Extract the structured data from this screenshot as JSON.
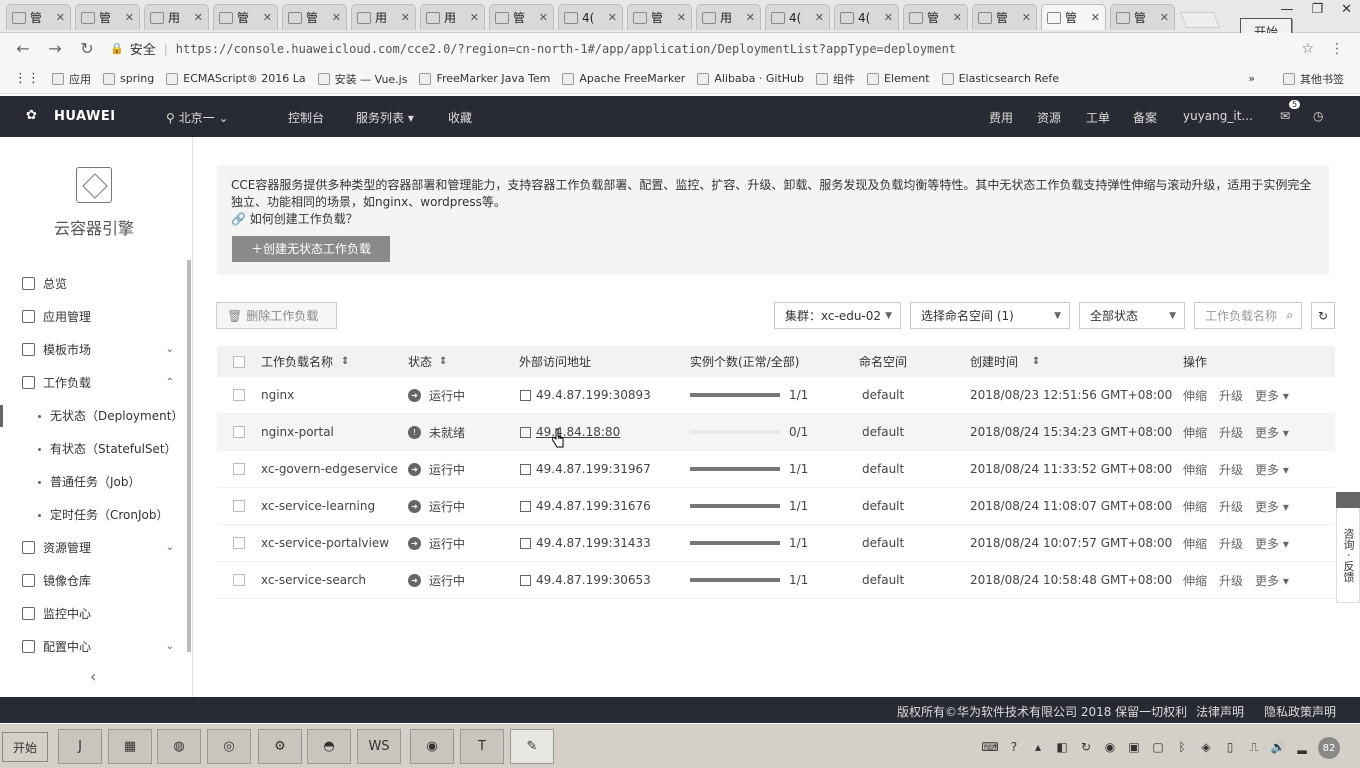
{
  "browser": {
    "tabs": [
      {
        "label": "管"
      },
      {
        "label": "管"
      },
      {
        "label": "用"
      },
      {
        "label": "管"
      },
      {
        "label": "管"
      },
      {
        "label": "用"
      },
      {
        "label": "用"
      },
      {
        "label": "管"
      },
      {
        "label": "4("
      },
      {
        "label": "管"
      },
      {
        "label": "用"
      },
      {
        "label": "4("
      },
      {
        "label": "4("
      },
      {
        "label": "管"
      },
      {
        "label": "管"
      },
      {
        "label": "管",
        "active": true
      },
      {
        "label": "管"
      }
    ],
    "tab_close": "✕",
    "start_popup": "开始",
    "popup_tag": "Po",
    "secure_label": "安全",
    "url": "https://console.huaweicloud.com/cce2.0/?region=cn-north-1#/app/application/DeploymentList?appType=deployment",
    "bookmarks": [
      "应用",
      "spring",
      "ECMAScript® 2016 La",
      "安装 — Vue.js",
      "FreeMarker Java Tem",
      "Apache FreeMarker",
      "Alibaba · GitHub",
      "组件",
      "Element",
      "Elasticsearch Refe"
    ],
    "bookmarks_more": "»",
    "other_bookmarks": "其他书签"
  },
  "header": {
    "brand": "HUAWEI",
    "region": "北京一",
    "nav": [
      "控制台",
      "服务列表 ▾",
      "收藏"
    ],
    "right": [
      "费用",
      "资源",
      "工单",
      "备案",
      "yuyang_it..."
    ],
    "notify_count": "5"
  },
  "sidebar": {
    "title": "云容器引擎",
    "items": [
      {
        "label": "总览"
      },
      {
        "label": "应用管理"
      },
      {
        "label": "模板市场",
        "chev": "⌄"
      },
      {
        "label": "工作负载",
        "chev": "⌃"
      },
      {
        "label": "无状态（Deployment）",
        "sub": true,
        "selected": true
      },
      {
        "label": "有状态（StatefulSet）",
        "sub": true
      },
      {
        "label": "普通任务（Job）",
        "sub": true
      },
      {
        "label": "定时任务（CronJob）",
        "sub": true
      },
      {
        "label": "资源管理",
        "chev": "⌄"
      },
      {
        "label": "镜像仓库"
      },
      {
        "label": "监控中心"
      },
      {
        "label": "配置中心",
        "chev": "⌄"
      }
    ],
    "collapse": "‹"
  },
  "intro": {
    "text": "CCE容器服务提供多种类型的容器部署和管理能力，支持容器工作负载部署、配置、监控、扩容、升级、卸载、服务发现及负载均衡等特性。其中无状态工作负载支持弹性伸缩与滚动升级，适用于实例完全独立、功能相同的场景，如nginx、wordpress等。",
    "link": "如何创建工作负载？",
    "create_button": "创建无状态工作负载"
  },
  "toolbar": {
    "delete": "删除工作负载",
    "cluster": "集群：xc-edu-02",
    "namespace": "选择命名空间 (1)",
    "status": "全部状态",
    "search_placeholder": "工作负载名称"
  },
  "table": {
    "headers": [
      "工作负载名称",
      "状态",
      "外部访问地址",
      "实例个数(正常/全部)",
      "命名空间",
      "创建时间",
      "操作"
    ],
    "rows": [
      {
        "name": "nginx",
        "status": "运行中",
        "addr": "49.4.87.199:30893",
        "count": "1/1",
        "ratio": 1,
        "ns": "default",
        "time": "2018/08/23 12:51:56 GMT+08:00"
      },
      {
        "name": "nginx-portal",
        "status": "未就绪",
        "addr": "49.4.84.18:80",
        "count": "0/1",
        "ratio": 0,
        "ns": "default",
        "time": "2018/08/24 15:34:23 GMT+08:00"
      },
      {
        "name": "xc-govern-edgeservice",
        "status": "运行中",
        "addr": "49.4.87.199:31967",
        "count": "1/1",
        "ratio": 1,
        "ns": "default",
        "time": "2018/08/24 11:33:52 GMT+08:00"
      },
      {
        "name": "xc-service-learning",
        "status": "运行中",
        "addr": "49.4.87.199:31676",
        "count": "1/1",
        "ratio": 1,
        "ns": "default",
        "time": "2018/08/24 11:08:07 GMT+08:00"
      },
      {
        "name": "xc-service-portalview",
        "status": "运行中",
        "addr": "49.4.87.199:31433",
        "count": "1/1",
        "ratio": 1,
        "ns": "default",
        "time": "2018/08/24 10:07:57 GMT+08:00"
      },
      {
        "name": "xc-service-search",
        "status": "运行中",
        "addr": "49.4.87.199:30653",
        "count": "1/1",
        "ratio": 1,
        "ns": "default",
        "time": "2018/08/24 10:58:48 GMT+08:00"
      }
    ],
    "ops": [
      "伸缩",
      "升级",
      "更多 ▾"
    ]
  },
  "feedback": "咨询 · 反馈",
  "footer": {
    "copyright": "版权所有©华为软件技术有限公司 2018 保留一切权利",
    "legal": "法律声明",
    "privacy": "隐私政策声明"
  },
  "taskbar": {
    "start": "开始",
    "apps": [
      "J",
      "▦",
      "◍",
      "◎",
      "⚙",
      "◓",
      "WS",
      "◉",
      "T",
      "✎"
    ],
    "clock": "82"
  }
}
